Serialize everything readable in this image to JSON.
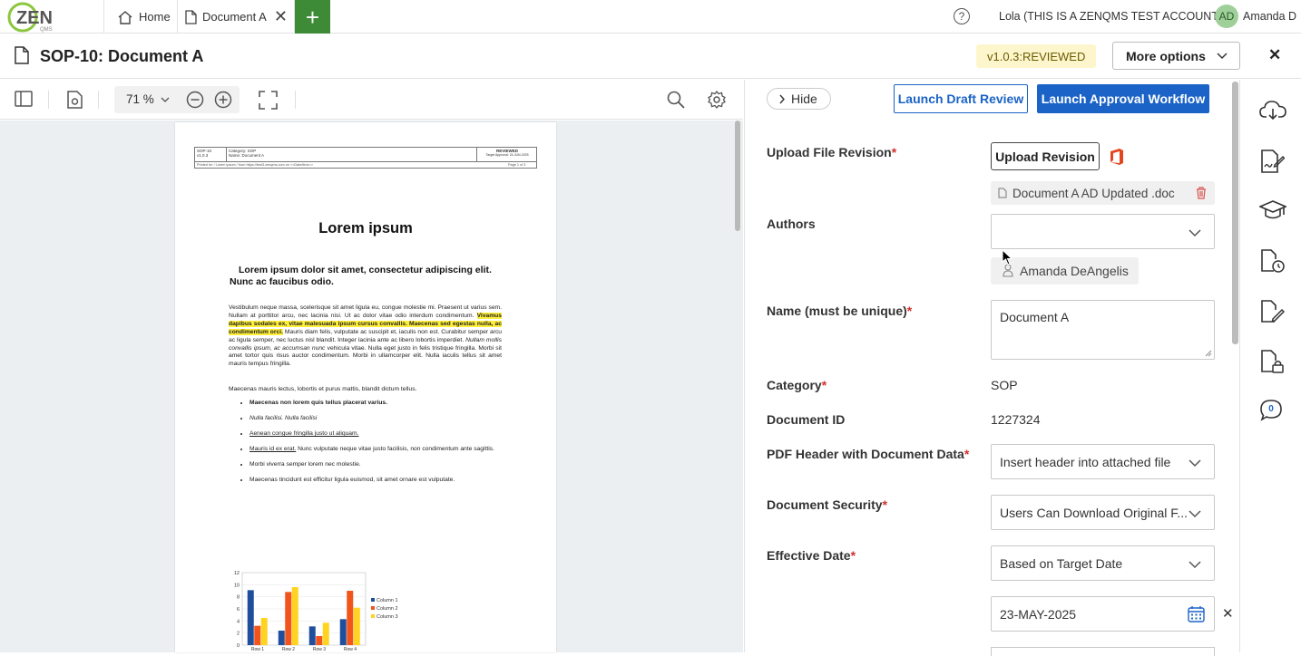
{
  "app": {
    "logo_text": "ZEN",
    "logo_sub": "QMS",
    "tabs": [
      {
        "label": "Home",
        "icon": "home-icon"
      },
      {
        "label": "Document A",
        "icon": "document-icon"
      }
    ],
    "account": "Lola (THIS IS A ZENQMS TEST ACCOUNT)",
    "user_initials": "AD",
    "user_name": "Amanda D",
    "accent_color": "#3d8b37"
  },
  "titlebar": {
    "title": "SOP-10: Document A",
    "version": "v1.0.3:REVIEWED",
    "more_options": "More options"
  },
  "viewer": {
    "zoom": "71 %",
    "page": {
      "header": {
        "doc_id": "SOP-10",
        "version": "v1.0.3",
        "category_label": "Category: SOP",
        "name_label": "Name: Document A",
        "status": "REVIEWED",
        "status_sub": "Target Approval: 24-JUN-2025",
        "printed": "Printed for / Lorem ipsum / from https://test3.zenqms.com on <<Date/time>>",
        "page_of": "Page 1 of 3"
      },
      "title": "Lorem ipsum",
      "subtitle": "Lorem ipsum dolor sit amet, consectetur adipiscing elit. Nunc ac faucibus odio.",
      "body_1": "Vestibulum neque massa, scelerisque sit amet ligula eu, congue molestie mi. Praesent ut varius sem. Nullam at porttitor arcu, nec lacinia nisi. Ut ac dolor vitae odio interdum condimentum.",
      "body_highlight": "Vivamus dapibus sodales ex, vitae malesuada ipsum cursus convallis. Maecenas sed egestas nulla, ac condimentum orci.",
      "body_2": "Mauris diam felis, vulputate ac suscipit et, iaculis non est. Curabitur semper arcu ac ligula semper, nec luctus nisl blandit. Integer lacinia ante ac libero lobortis imperdiet.",
      "body_italic": "Nullam mollis convallis ipsum, ac accumsan nunc",
      "body_3": "vehicula vitae. Nulla eget justo in felis tristique fringilla. Morbi sit amet tortor quis risus auctor condimentum. Morbi in ullamcorper elit. Nulla iaculis tellus sit amet mauris tempus fringilla.",
      "body_para2": "Maecenas mauris lectus, lobortis et purus mattis, blandit dictum tellus.",
      "list": [
        "Maecenas non lorem quis tellus placerat varius.",
        "Nulla facilisi. Nulla facilisi",
        "Aenean congue fringilla justo ut aliquam.",
        "Mauris id ex erat.",
        "Morbi viverra semper lorem nec molestie.",
        "Maecenas tincidunt est efficitur ligula euismod, sit amet ornare est vulputate."
      ],
      "list_4_rest": "Nunc vulputate neque vitae justo facilisis, non condimentum ante sagittis."
    }
  },
  "chart_data": {
    "type": "bar",
    "categories": [
      "Row 1",
      "Row 2",
      "Row 3",
      "Row 4"
    ],
    "series": [
      {
        "name": "Column 1",
        "values": [
          9.1,
          2.4,
          3.1,
          4.3
        ],
        "color": "#1f4e9c"
      },
      {
        "name": "Column 2",
        "values": [
          3.2,
          8.8,
          1.5,
          9.0
        ],
        "color": "#f2541b"
      },
      {
        "name": "Column 3",
        "values": [
          4.5,
          9.6,
          3.7,
          6.2
        ],
        "color": "#ffd320"
      }
    ],
    "ylim": [
      0,
      12
    ],
    "yticks": [
      "0",
      "2",
      "4",
      "6",
      "8",
      "10",
      "12"
    ],
    "legend": "right"
  },
  "panel": {
    "hide": "Hide",
    "launch_draft": "Launch Draft Review",
    "launch_approval": "Launch Approval Workflow",
    "primary_color": "#1b63c6",
    "upload_label": "Upload File Revision",
    "upload_btn": "Upload Revision",
    "file_name": "Document A AD Updated .doc",
    "authors_label": "Authors",
    "author_chip": "Amanda DeAngelis",
    "name_label": "Name (must be unique)",
    "name_value": "Document A",
    "category_label": "Category",
    "category_value": "SOP",
    "docid_label": "Document ID",
    "docid_value": "1227324",
    "pdfheader_label": "PDF Header with Document Data",
    "pdfheader_value": "Insert header into attached file",
    "security_label": "Document Security",
    "security_value": "Users Can Download Original F...",
    "effective_label": "Effective Date",
    "effective_value": "Based on Target Date",
    "date_value": "23-MAY-2025"
  },
  "rail": {
    "comment_count": "0"
  }
}
